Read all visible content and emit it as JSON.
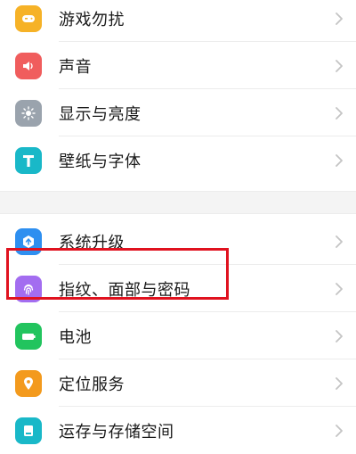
{
  "settings": {
    "group1": [
      {
        "id": "dnd",
        "label": "游戏勿扰",
        "icon": "game-controller-icon",
        "color": "#f6b227"
      },
      {
        "id": "sound",
        "label": "声音",
        "icon": "speaker-icon",
        "color": "#f05d5d"
      },
      {
        "id": "display",
        "label": "显示与亮度",
        "icon": "brightness-icon",
        "color": "#9aa3ad"
      },
      {
        "id": "wallpaper",
        "label": "壁纸与字体",
        "icon": "font-t-icon",
        "color": "#19b8c8"
      }
    ],
    "group2": [
      {
        "id": "update",
        "label": "系统升级",
        "icon": "system-update-icon",
        "color": "#2e8ff0"
      },
      {
        "id": "biometric",
        "label": "指纹、面部与密码",
        "icon": "fingerprint-icon",
        "color": "#a36df0"
      },
      {
        "id": "battery",
        "label": "电池",
        "icon": "battery-icon",
        "color": "#22c45e"
      },
      {
        "id": "location",
        "label": "定位服务",
        "icon": "location-pin-icon",
        "color": "#f39a1d"
      },
      {
        "id": "storage",
        "label": "运存与存储空间",
        "icon": "storage-icon",
        "color": "#19b8c8"
      }
    ]
  },
  "highlight": {
    "color": "#e0121f",
    "target": "biometric"
  }
}
